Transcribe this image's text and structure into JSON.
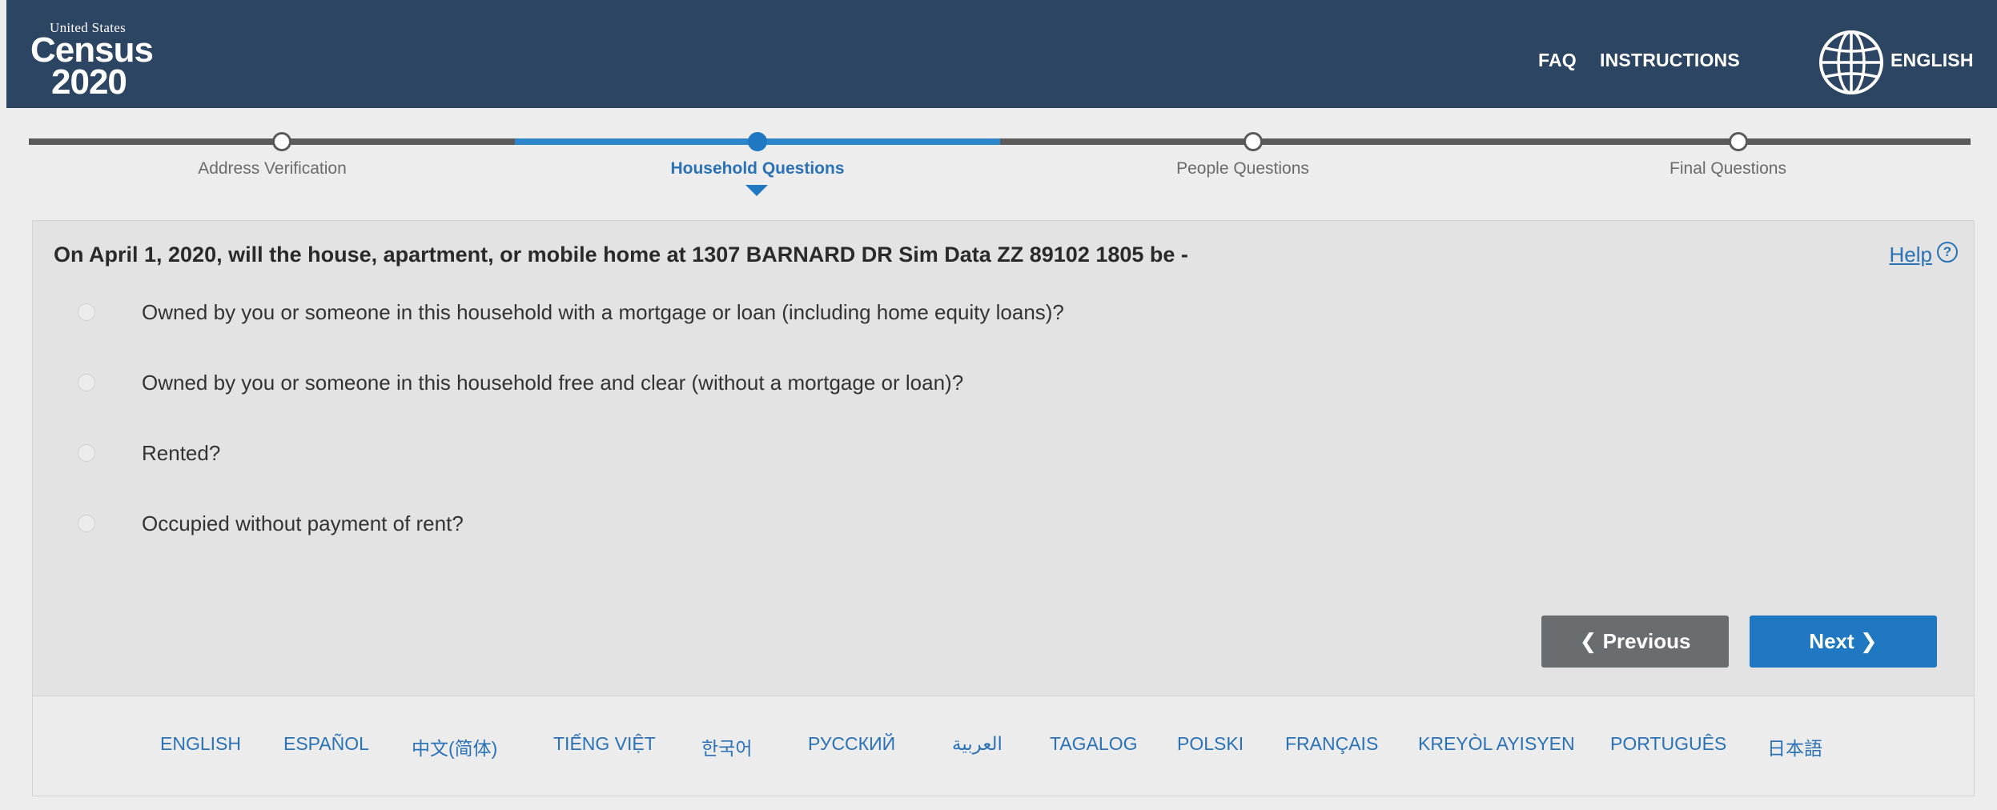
{
  "header": {
    "logo_small": "United States",
    "logo_big": "Census",
    "logo_year": "2020",
    "faq": "FAQ",
    "instructions": "INSTRUCTIONS",
    "language": "ENGLISH",
    "language_icon": "globe-icon",
    "colors": {
      "background": "#2c4563",
      "text": "#ffffff"
    }
  },
  "progress": {
    "steps": [
      {
        "label": "Address Verification",
        "status": "complete"
      },
      {
        "label": "Household Questions",
        "status": "current"
      },
      {
        "label": "People Questions",
        "status": "pending"
      },
      {
        "label": "Final Questions",
        "status": "pending"
      }
    ],
    "colors": {
      "active": "#1f78c1",
      "inactive": "#5a5a5a"
    }
  },
  "main": {
    "question": "On April 1, 2020, will the house, apartment, or mobile home at 1307 BARNARD DR Sim Data ZZ 89102 1805 be -",
    "help_label": "Help",
    "help_icon": "question-circle-icon",
    "options": [
      {
        "label": "Owned by you or someone in this household with a mortgage or loan (including home equity loans)?",
        "selected": false
      },
      {
        "label": "Owned by you or someone in this household free and clear (without a mortgage or loan)?",
        "selected": false
      },
      {
        "label": "Rented?",
        "selected": false
      },
      {
        "label": "Occupied without payment of rent?",
        "selected": false
      }
    ],
    "previous_label": "Previous",
    "next_label": "Next",
    "colors": {
      "previous": "#6a6d70",
      "next": "#1f78c1",
      "link": "#2a72b5"
    }
  },
  "footer": {
    "languages": [
      "ENGLISH",
      "ESPAÑOL",
      "中文(简体)",
      "TIẾNG VIỆT",
      "한국어",
      "РУССКИЙ",
      "العربية",
      "TAGALOG",
      "POLSKI",
      "FRANÇAIS",
      "KREYÒL AYISYEN",
      "PORTUGUÊS",
      "日本語"
    ]
  }
}
